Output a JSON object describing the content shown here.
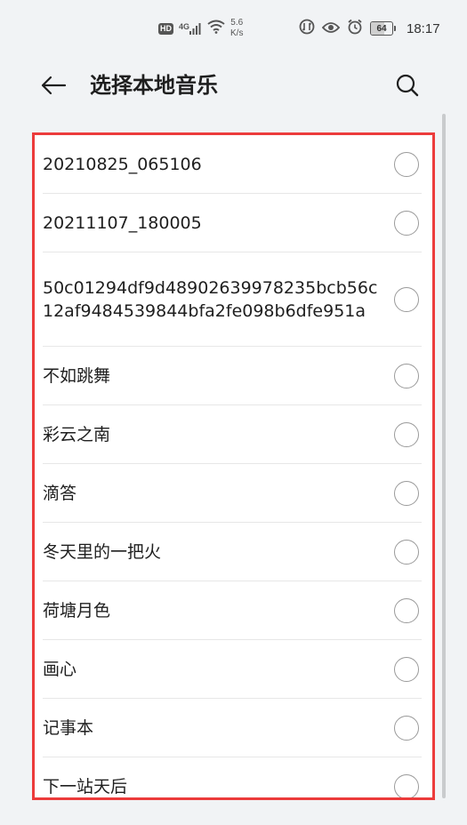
{
  "status_bar": {
    "hd_label": "HD",
    "network_label": "4G",
    "speed_value": "5.6",
    "speed_unit": "K/s",
    "battery_level": "64",
    "battery_fraction": 0.64,
    "time": "18:17"
  },
  "app_bar": {
    "title": "选择本地音乐",
    "back_icon": "back-arrow-icon",
    "search_icon": "search-icon"
  },
  "music_list": {
    "items": [
      {
        "label": "20210825_065106",
        "selected": false
      },
      {
        "label": "20211107_180005",
        "selected": false
      },
      {
        "label": "50c01294df9d48902639978235bcb56c12af9484539844bfa2fe098b6dfe951a",
        "selected": false
      },
      {
        "label": "不如跳舞",
        "selected": false
      },
      {
        "label": "彩云之南",
        "selected": false
      },
      {
        "label": "滴答",
        "selected": false
      },
      {
        "label": "冬天里的一把火",
        "selected": false
      },
      {
        "label": "荷塘月色",
        "selected": false
      },
      {
        "label": "画心",
        "selected": false
      },
      {
        "label": "记事本",
        "selected": false
      },
      {
        "label": "下一站天后",
        "selected": false
      }
    ]
  },
  "colors": {
    "highlight_border": "#ec3b3b",
    "background": "#f1f3f5",
    "panel": "#ffffff"
  }
}
